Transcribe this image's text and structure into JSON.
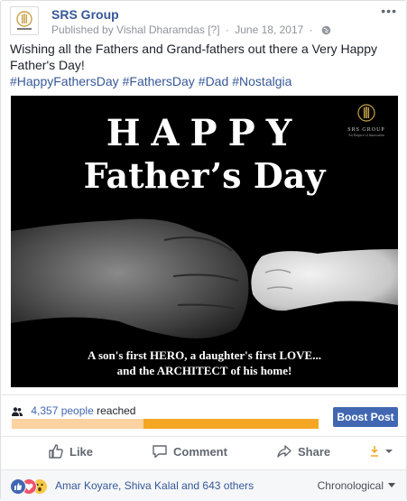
{
  "post": {
    "page_name": "SRS Group",
    "published_by": "Published by Vishal Dharamdas",
    "help_marker": "[?]",
    "date": "June 18, 2017",
    "more_label": "•••",
    "text": "Wishing all the Fathers and Grand-fathers out there a Very Happy Father's Day!",
    "hashtags": [
      "#HappyFathersDay",
      "#FathersDay",
      "#Dad",
      "#Nostalgia"
    ]
  },
  "photo": {
    "title_line1": "HAPPY",
    "title_line2": "Father’s Day",
    "logo_text": "SRS GROUP",
    "logo_tagline": "An Empire of Innovation",
    "caption_line1": "A son's first HERO, a daughter's first LOVE...",
    "caption_line2": "and the ARCHITECT of his home!"
  },
  "reach": {
    "count": "4,357 people",
    "label": "reached",
    "organic_fraction": 0.43,
    "organic_color": "#fbd2a0",
    "paid_color": "#f5a623",
    "boost_label": "Boost Post"
  },
  "actions": {
    "like": "Like",
    "comment": "Comment",
    "share": "Share"
  },
  "footer": {
    "reactors": "Amar Koyare, Shiva Kalal and 643 others",
    "sort_label": "Chronological",
    "reaction_icons": [
      "like-icon",
      "love-icon",
      "wow-icon"
    ]
  },
  "colors": {
    "link": "#365899",
    "accent": "#4267b2",
    "muted": "#90949c"
  }
}
